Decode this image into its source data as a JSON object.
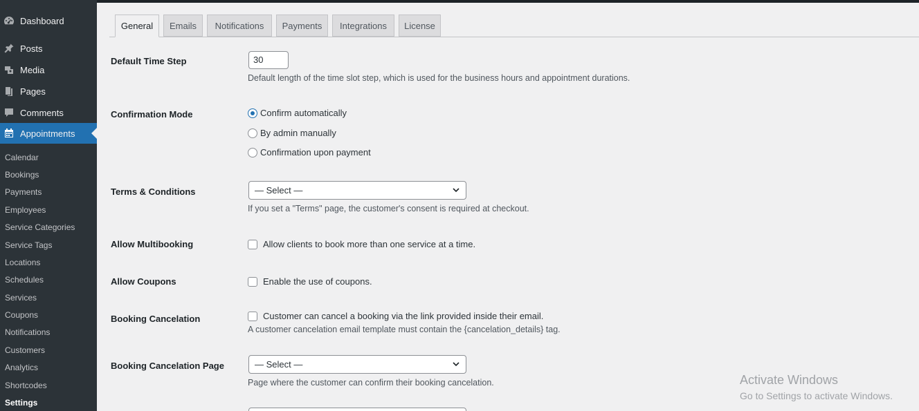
{
  "sidebar": {
    "menu": [
      {
        "label": "Dashboard",
        "icon": "dashboard-icon"
      },
      {
        "label": "Posts",
        "icon": "pin-icon"
      },
      {
        "label": "Media",
        "icon": "media-icon"
      },
      {
        "label": "Pages",
        "icon": "pages-icon"
      },
      {
        "label": "Comments",
        "icon": "comment-icon"
      },
      {
        "label": "Appointments",
        "icon": "calendar-icon"
      }
    ],
    "submenu": [
      "Calendar",
      "Bookings",
      "Payments",
      "Employees",
      "Service Categories",
      "Service Tags",
      "Locations",
      "Schedules",
      "Services",
      "Coupons",
      "Notifications",
      "Customers",
      "Analytics",
      "Shortcodes",
      "Settings"
    ],
    "active_menu": "Appointments",
    "current_submenu": "Settings"
  },
  "tabs": [
    "General",
    "Emails",
    "Notifications",
    "Payments",
    "Integrations",
    "License"
  ],
  "active_tab": "General",
  "form": {
    "time_step": {
      "label": "Default Time Step",
      "value": "30",
      "description": "Default length of the time slot step, which is used for the business hours and appointment durations."
    },
    "confirmation": {
      "label": "Confirmation Mode",
      "options": [
        "Confirm automatically",
        "By admin manually",
        "Confirmation upon payment"
      ],
      "selected": "Confirm automatically"
    },
    "terms": {
      "label": "Terms & Conditions",
      "select_value": "— Select —",
      "description": "If you set a \"Terms\" page, the customer's consent is required at checkout."
    },
    "multibooking": {
      "label": "Allow Multibooking",
      "checkbox_label": "Allow clients to book more than one service at a time.",
      "checked": false
    },
    "coupons": {
      "label": "Allow Coupons",
      "checkbox_label": "Enable the use of coupons.",
      "checked": false
    },
    "cancelation": {
      "label": "Booking Cancelation",
      "checkbox_label": "Customer can cancel a booking via the link provided inside their email.",
      "description": "A customer cancelation email template must contain the {cancelation_details} tag.",
      "checked": false
    },
    "cancelation_page": {
      "label": "Booking Cancelation Page",
      "select_value": "— Select —",
      "description": "Page where the customer can confirm their booking cancelation."
    }
  },
  "watermark": {
    "title": "Activate Windows",
    "subtitle": "Go to Settings to activate Windows."
  },
  "colors": {
    "sidebar_bg": "#2c3338",
    "accent": "#2271b1",
    "page_bg": "#f0f0f1"
  }
}
